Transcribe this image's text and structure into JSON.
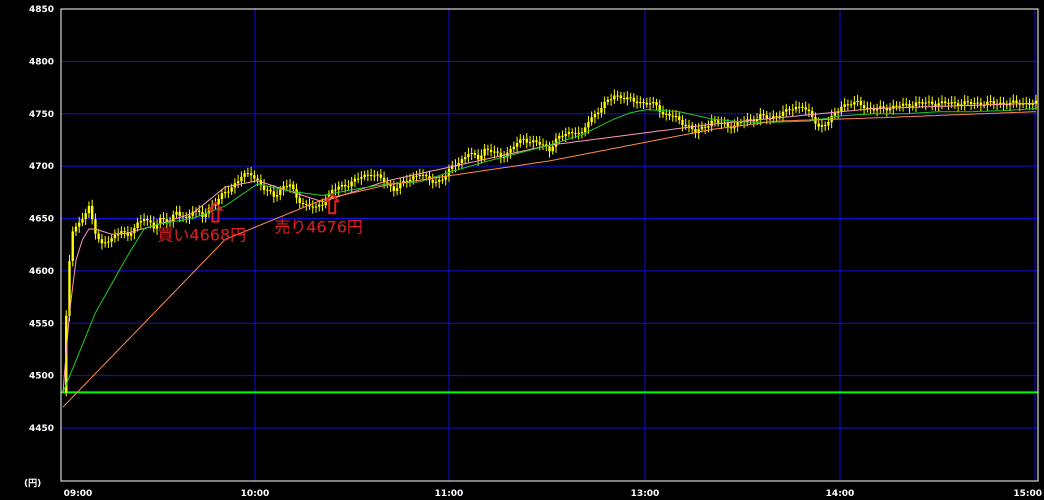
{
  "chart_data": {
    "type": "line",
    "x_unit_label": "(円)",
    "x_ticks": [
      "09:00",
      "10:00",
      "11:00",
      "13:00",
      "14:00",
      "15:00"
    ],
    "y_ticks": [
      4450,
      4500,
      4550,
      4600,
      4650,
      4700,
      4750,
      4800,
      4850
    ],
    "ylim": [
      4410,
      4850
    ],
    "x_index_range": [
      0,
      300
    ],
    "grid": true,
    "colors": {
      "background": "#000000",
      "grid": "#1010d8",
      "frame": "#ffffff",
      "candle": "#ffff00",
      "ma_short": "#ff9ab8",
      "ma_mid": "#22cc22",
      "ma_long": "#ff8a50",
      "reference": "#00ff00",
      "annotation": "#e02020"
    },
    "reference_line": 4484,
    "price": {
      "x": [
        0,
        1,
        2,
        3,
        5,
        8,
        10,
        12,
        15,
        18,
        20,
        23,
        25,
        28,
        30,
        33,
        35,
        38,
        40,
        43,
        45,
        48,
        50,
        52,
        55,
        58,
        60,
        62,
        65,
        68,
        70,
        72,
        75,
        78,
        80,
        83,
        85,
        88,
        90,
        92,
        95,
        98,
        100,
        102,
        105,
        108,
        110,
        112,
        115,
        118,
        120,
        123,
        125,
        128,
        130,
        133,
        135,
        138,
        140,
        142,
        145,
        148,
        150,
        152,
        155,
        158,
        160,
        162,
        165,
        168,
        170,
        172,
        175,
        178,
        180,
        183,
        185,
        188,
        190,
        193,
        195,
        198,
        200,
        203,
        205,
        208,
        210,
        213,
        215,
        218,
        220,
        223,
        225,
        228,
        230,
        233,
        235,
        238,
        240,
        243,
        245,
        248,
        250,
        253,
        255,
        258,
        260,
        263,
        265,
        268,
        270,
        273,
        275,
        278,
        280,
        283,
        285,
        288,
        290,
        293,
        295,
        298,
        300
      ],
      "values": [
        4484,
        4555,
        4610,
        4640,
        4645,
        4660,
        4638,
        4625,
        4630,
        4640,
        4632,
        4645,
        4652,
        4640,
        4650,
        4648,
        4655,
        4650,
        4658,
        4652,
        4660,
        4668,
        4675,
        4680,
        4690,
        4693,
        4686,
        4678,
        4672,
        4680,
        4682,
        4670,
        4662,
        4660,
        4665,
        4676,
        4680,
        4683,
        4686,
        4690,
        4693,
        4688,
        4683,
        4678,
        4684,
        4690,
        4693,
        4688,
        4685,
        4690,
        4700,
        4706,
        4712,
        4708,
        4716,
        4713,
        4709,
        4715,
        4722,
        4726,
        4723,
        4720,
        4716,
        4725,
        4731,
        4733,
        4730,
        4743,
        4753,
        4762,
        4768,
        4766,
        4763,
        4761,
        4760,
        4758,
        4750,
        4748,
        4743,
        4738,
        4732,
        4738,
        4743,
        4741,
        4738,
        4740,
        4743,
        4745,
        4748,
        4745,
        4749,
        4752,
        4755,
        4758,
        4750,
        4738,
        4740,
        4749,
        4758,
        4760,
        4760,
        4756,
        4754,
        4755,
        4756,
        4758,
        4758,
        4760,
        4760,
        4760,
        4760,
        4760,
        4760,
        4760,
        4760,
        4760,
        4760,
        4760,
        4760,
        4760,
        4760,
        4760,
        4760
      ]
    },
    "series": [
      {
        "values_x": [
          0,
          2,
          4,
          6,
          8,
          10,
          15,
          20,
          30,
          40,
          50,
          60,
          80,
          100,
          150,
          200,
          250,
          300
        ],
        "values": [
          4484,
          4560,
          4610,
          4630,
          4640,
          4640,
          4635,
          4636,
          4645,
          4655,
          4680,
          4686,
          4666,
          4686,
          4720,
          4740,
          4755,
          4760
        ]
      },
      {
        "values_x": [
          0,
          10,
          20,
          25,
          30,
          40,
          50,
          60,
          70,
          80,
          90,
          100,
          110,
          120,
          130,
          140,
          150,
          160,
          170,
          175,
          180,
          190,
          200,
          210,
          220,
          230,
          240,
          250,
          260,
          270,
          280,
          290,
          300
        ],
        "values": [
          4484,
          4560,
          4615,
          4640,
          4645,
          4650,
          4662,
          4683,
          4676,
          4672,
          4678,
          4683,
          4685,
          4695,
          4704,
          4712,
          4720,
          4730,
          4745,
          4751,
          4754,
          4752,
          4745,
          4742,
          4742,
          4743,
          4748,
          4750,
          4750,
          4752,
          4752,
          4753,
          4755
        ]
      },
      {
        "values_x": [
          0,
          50,
          80,
          100,
          150,
          200,
          220,
          250,
          300
        ],
        "values": [
          4470,
          4630,
          4668,
          4682,
          4705,
          4735,
          4743,
          4746,
          4752
        ]
      }
    ],
    "annotations": [
      {
        "text": "買い4668円",
        "x": 47,
        "value": 4668
      },
      {
        "text": "売り4676円",
        "x": 83,
        "value": 4676
      }
    ]
  }
}
